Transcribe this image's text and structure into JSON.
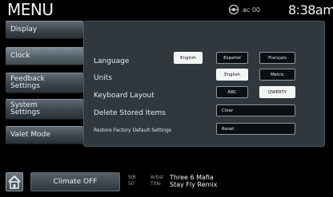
{
  "header": {
    "title": "MENU",
    "status_text": "ac 00",
    "clock": "8:38am"
  },
  "sidebar": {
    "items": [
      {
        "label": "Display"
      },
      {
        "label": "Clock"
      },
      {
        "label": "Feedback Settings"
      },
      {
        "label": "System Settings"
      },
      {
        "label": "Valet Mode"
      }
    ]
  },
  "settings": {
    "language": {
      "label": "Language",
      "options": [
        "English",
        "Español",
        "Français"
      ],
      "selected": "English"
    },
    "units": {
      "label": "Units",
      "options": [
        "English",
        "Metric"
      ],
      "selected": "English"
    },
    "keyboard_layout": {
      "label": "Keyboard Layout",
      "options": [
        "ABC",
        "QWERTY"
      ],
      "selected": "QWERTY"
    },
    "delete_stored_items": {
      "label": "Delete Stored Items",
      "button_label": "Clear"
    },
    "restore_defaults": {
      "label": "Restore Factory Default Settings",
      "button_label": "Reset"
    }
  },
  "bottom_bar": {
    "climate_label": "Climate OFF",
    "now_playing": {
      "source": "SIR",
      "channel": "50",
      "artist_label": "Artist",
      "title_label": "Title",
      "artist": "Three 6 Mafia",
      "title": "Stay Fly Remix"
    }
  },
  "colors": {
    "panel_bg": "#30383e",
    "selected_button": "#f3f4f4",
    "sidebar_button": "#4a555c"
  }
}
